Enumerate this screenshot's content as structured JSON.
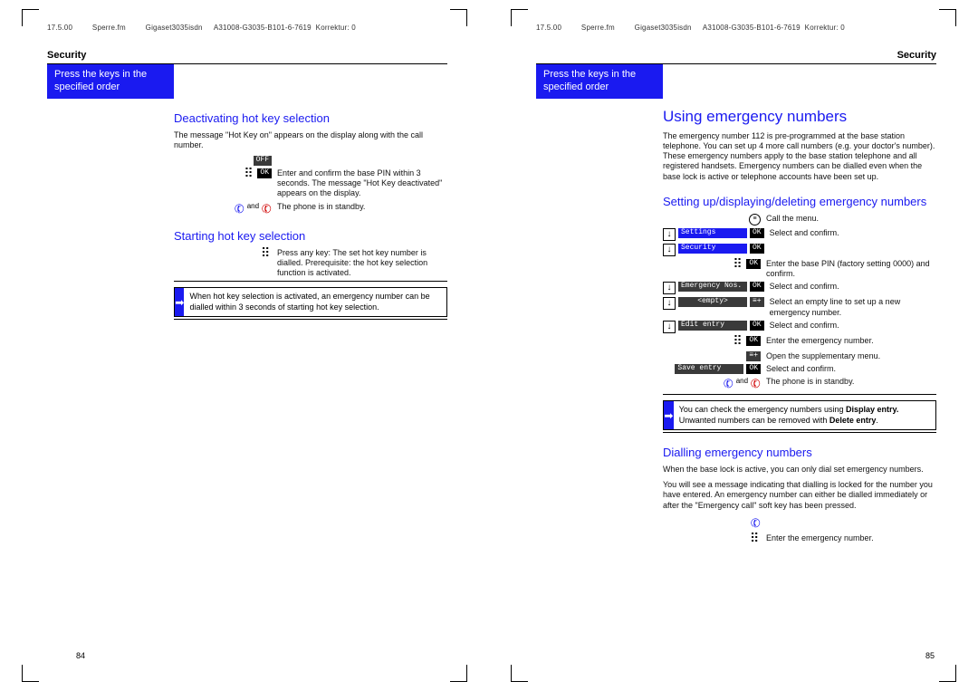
{
  "header": {
    "date": "17.5.00",
    "file": "Sperre.fm",
    "doc": "Gigaset3035isdn",
    "id": "A31008-G3035-B101-6-7619",
    "corr": "Korrektur: 0"
  },
  "common": {
    "section": "Security",
    "bluebox": "Press the keys in the specified order",
    "ok": "OK",
    "and": "and",
    "standby": "The phone is in standby.",
    "selectconfirm": "Select and confirm.",
    "arrow": "➡"
  },
  "left": {
    "h2a": "Deactivating hot key selection",
    "p1": "The message \"Hot Key on\" appears on the display along with the call number.",
    "off": "OFF",
    "p2": "Enter and confirm the base PIN within 3 seconds. The message \"Hot Key deactivated\" appears on the display.",
    "h2b": "Starting hot key selection",
    "p3": "Press any key: The set hot key number is dialled. Prerequisite: the hot key selection function is activated.",
    "tip": "When hot key selection is activated, an emergency number can be dialled within 3 seconds of starting hot key selection.",
    "pagenum": "84"
  },
  "right": {
    "h1": "Using emergency numbers",
    "intro": "The emergency number 112 is pre-programmed at the base station telephone. You can set up 4 more call numbers (e.g. your doctor's number). These emergency numbers apply to the base station telephone and all registered handsets. Emergency numbers can be dialled even when the base lock is active or telephone accounts have been set up.",
    "h2a": "Setting up/displaying/deleting emergency numbers",
    "callmenu": "Call the menu.",
    "settings": "Settings",
    "security": "Security",
    "enterpin": "Enter the base PIN (factory setting 0000) and confirm.",
    "emergnos": "Emergency Nos.",
    "empty": "<empty>",
    "selectempty": "Select an empty line to set up a new emergency number.",
    "editentry": "Edit entry",
    "enteremerg": "Enter the emergency number.",
    "opensupp": "Open the supplementary menu.",
    "saveentry": "Save entry",
    "tip": "You can check the emergency numbers using Dis­play entry. Unwanted numbers can be removed with Delete entry.",
    "tipb1": "Dis­play entry.",
    "tipb2": "Delete entry",
    "h2b": "Dialling emergency numbers",
    "p5": "When the base lock is active, you can only dial set emergency numbers.",
    "p6": "You will see a message indicating that dialling is locked for the number you have entered. An emergency number can either be dialled immediately or after the \"Emergency call\" soft key has been pressed.",
    "enteremerg2": "Enter the emergency number.",
    "pagenum": "85",
    "plusminus": "≡+"
  }
}
